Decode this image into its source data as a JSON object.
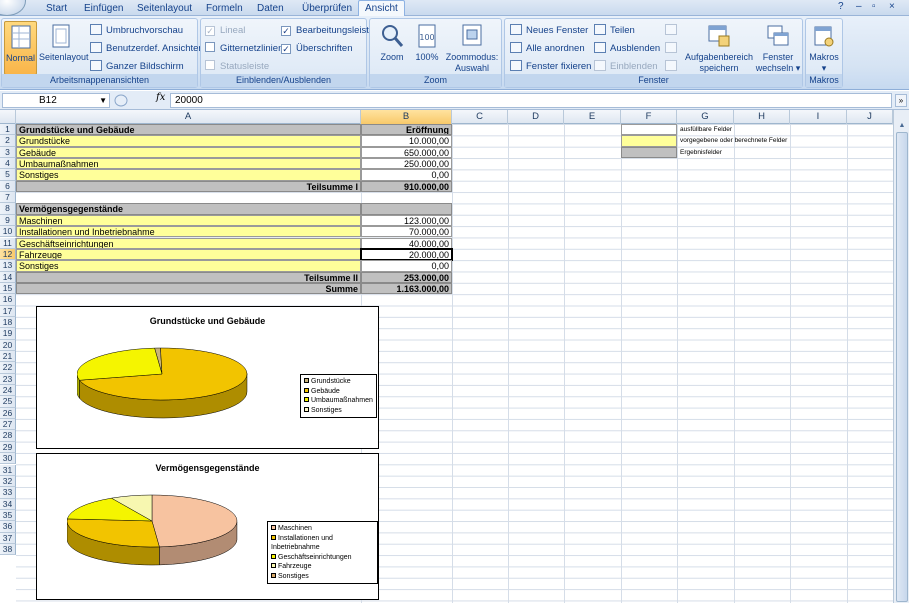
{
  "tabs": [
    "Start",
    "Einfügen",
    "Seitenlayout",
    "Formeln",
    "Daten",
    "Überprüfen",
    "Ansicht"
  ],
  "active_tab": "Ansicht",
  "window_controls": {
    "help": "?",
    "minimize": "–",
    "restore": "▫",
    "close": "×"
  },
  "ribbon": {
    "arbeitsmappenansichten": {
      "label": "Arbeitsmappenansichten",
      "normal": "Normal",
      "seitenlayout": "Seitenlayout",
      "umbruchvorschau": "Umbruchvorschau",
      "benutzerdef": "Benutzerdef. Ansichten",
      "ganzer": "Ganzer Bildschirm"
    },
    "einblenden": {
      "label": "Einblenden/Ausblenden",
      "lineal": "Lineal",
      "gitternetzlinien": "Gitternetzlinien",
      "statusleiste": "Statusleiste",
      "bearbeitungsleiste": "Bearbeitungsleiste",
      "ueberschriften": "Überschriften",
      "check": "✓"
    },
    "zoom": {
      "label": "Zoom",
      "zoom": "Zoom",
      "hundert": "100%",
      "auswahl_line1": "Zoommodus:",
      "auswahl_line2": "Auswahl"
    },
    "fenster": {
      "label": "Fenster",
      "neues": "Neues Fenster",
      "alle": "Alle anordnen",
      "fixieren": "Fenster fixieren ▾",
      "teilen": "Teilen",
      "ausblenden": "Ausblenden",
      "einblenden": "Einblenden",
      "aufgaben_line1": "Aufgabenbereich",
      "aufgaben_line2": "speichern",
      "wechseln_line1": "Fenster",
      "wechseln_line2": "wechseln ▾"
    },
    "makros": {
      "label": "Makros",
      "makros": "Makros",
      "arrow": "▾"
    }
  },
  "formula_bar": {
    "name_box": "B12",
    "fx": "fx",
    "value": "20000"
  },
  "columns": [
    "A",
    "B",
    "C",
    "D",
    "E",
    "F",
    "G",
    "H",
    "I",
    "J"
  ],
  "selected_column": "B",
  "rows": [
    "1",
    "2",
    "3",
    "4",
    "5",
    "6",
    "7",
    "8",
    "9",
    "10",
    "11",
    "12",
    "13",
    "14",
    "15",
    "16",
    "17",
    "18",
    "19",
    "20",
    "21",
    "22",
    "23",
    "24",
    "25",
    "26",
    "27",
    "28",
    "29",
    "30",
    "31",
    "32",
    "33",
    "34",
    "35",
    "36",
    "37",
    "38"
  ],
  "selected_row": "12",
  "sheet": {
    "r1": {
      "a": "Grundstücke und Gebäude",
      "b": "Eröffnung"
    },
    "r2": {
      "a": "Grundstücke",
      "b": "10.000,00"
    },
    "r3": {
      "a": "Gebäude",
      "b": "650.000,00"
    },
    "r4": {
      "a": "Umbaumaßnahmen",
      "b": "250.000,00"
    },
    "r5": {
      "a": "Sonstiges",
      "b": "0,00"
    },
    "r6": {
      "a": "Teilsumme I",
      "b": "910.000,00"
    },
    "r8": {
      "a": "Vermögensgegenstände"
    },
    "r9": {
      "a": "Maschinen",
      "b": "123.000,00"
    },
    "r10": {
      "a": "Installationen und Inbetriebnahme",
      "b": "70.000,00"
    },
    "r11": {
      "a": "Geschäftseinrichtungen",
      "b": "40.000,00"
    },
    "r12": {
      "a": "Fahrzeuge",
      "b": "20.000,00"
    },
    "r13": {
      "a": "Sonstiges",
      "b": "0,00"
    },
    "r14": {
      "a": "Teilsumme II",
      "b": "253.000,00"
    },
    "r15": {
      "a": "Summe",
      "b": "1.163.000,00"
    }
  },
  "cell_legend": [
    {
      "label": "ausfüllbare Felder",
      "color": "#ffffff"
    },
    {
      "label": "vorgegebene oder berechnete Felder",
      "color": "#ffff9a"
    },
    {
      "label": "Ergebnisfelder",
      "color": "#c0c0c0"
    }
  ],
  "chart_data": [
    {
      "type": "pie",
      "title": "Grundstücke und Gebäude",
      "categories": [
        "Grundstücke",
        "Gebäude",
        "Umbaumaßnahmen",
        "Sonstiges"
      ],
      "values": [
        10000,
        650000,
        250000,
        0
      ],
      "colors": [
        "#c8b37a",
        "#f2c400",
        "#f5f500",
        "#fff7c8"
      ],
      "legend": "right"
    },
    {
      "type": "pie",
      "title": "Vermögensgegenstände",
      "categories": [
        "Maschinen",
        "Installationen und Inbetriebnahme",
        "Geschäftseinrichtungen",
        "Fahrzeuge",
        "Sonstiges"
      ],
      "values": [
        123000,
        70000,
        40000,
        20000,
        0
      ],
      "colors": [
        "#f7c3a0",
        "#f2c400",
        "#f5f500",
        "#f7f7b0",
        "#d8a96a"
      ],
      "legend": "right"
    }
  ]
}
